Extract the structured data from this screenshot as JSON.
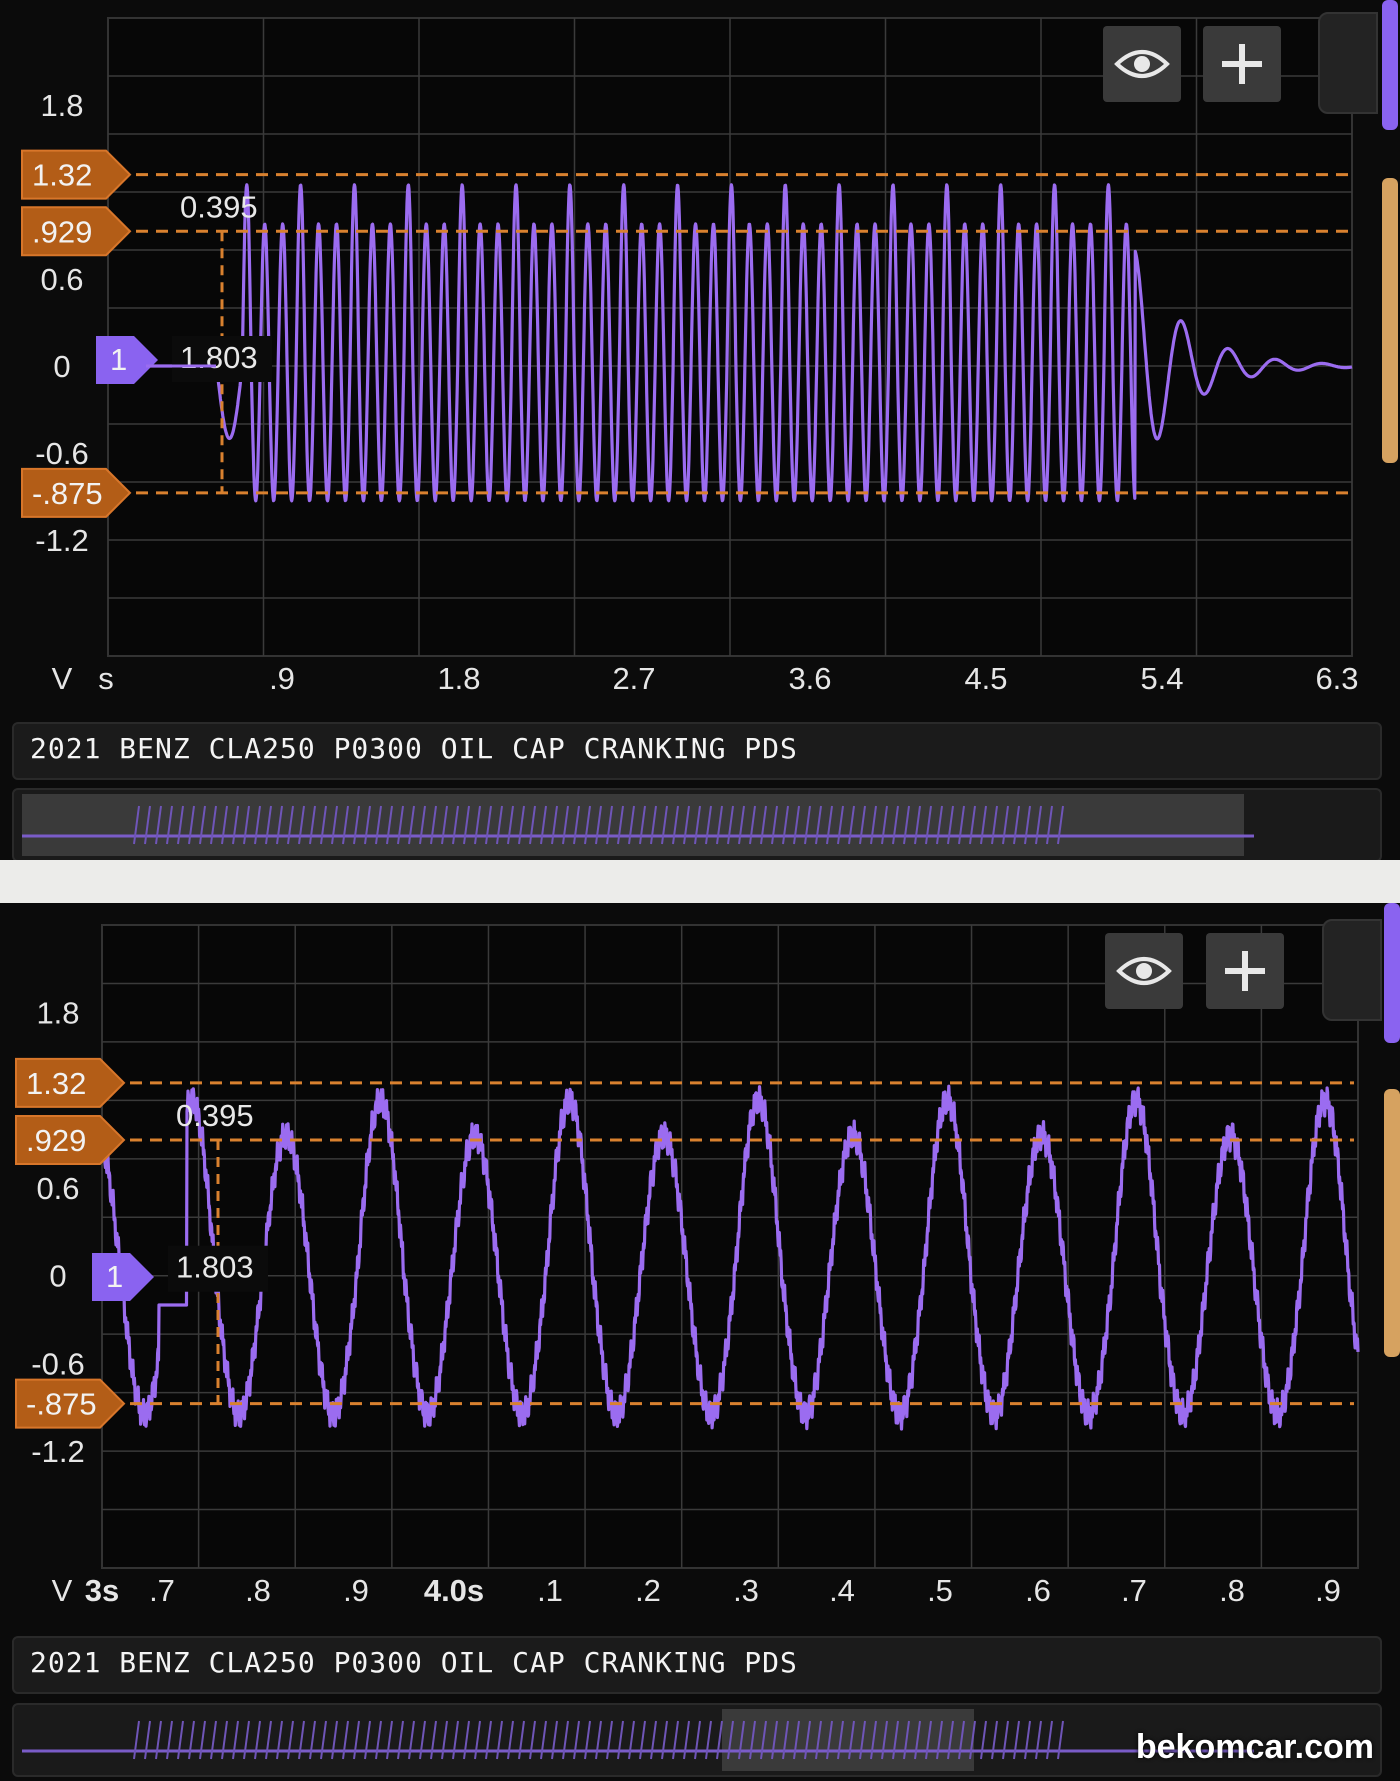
{
  "colors": {
    "trace": "#9b6cf0",
    "cursor": "#d9812f",
    "grid": "#3a3a3a",
    "background": "#0b0b0b",
    "tab_purple": "#8a63f0",
    "tab_orange": "#d6a260"
  },
  "icons": {
    "view": "eye-icon",
    "add": "plus-icon"
  },
  "watermark": "bekomcar.com",
  "panels": [
    {
      "title": "2021 BENZ CLA250 P0300 OIL CAP CRANKING PDS",
      "y_tick_labels": [
        "1.8",
        "0.6",
        "0",
        "-0.6",
        "-1.2"
      ],
      "y_unit": "V",
      "x_unit": "s",
      "x_tick_labels": [
        ".9",
        "1.8",
        "2.7",
        "3.6",
        "4.5",
        "5.4",
        "6.3"
      ],
      "cursor_labels": [
        "1.32",
        ".929",
        "-.875"
      ],
      "delta_top": "0.395",
      "delta_time": "1.803",
      "channel_label": "1"
    },
    {
      "title": "2021 BENZ CLA250 P0300 OIL CAP CRANKING PDS",
      "y_tick_labels": [
        "1.8",
        "0.6",
        "0",
        "-0.6",
        "-1.2"
      ],
      "y_unit": "V",
      "x_tick_labels": [
        "3s",
        ".7",
        ".8",
        ".9",
        "4.0s",
        ".1",
        ".2",
        ".3",
        ".4",
        ".5",
        ".6",
        ".7",
        ".8",
        ".9"
      ],
      "cursor_labels": [
        "1.32",
        ".929",
        "-.875"
      ],
      "delta_top": "0.395",
      "delta_time": "1.803",
      "channel_label": "1"
    }
  ],
  "chart_data": [
    {
      "type": "line",
      "title": "",
      "xlabel": "s",
      "ylabel": "V",
      "xlim": [
        0,
        6.3
      ],
      "ylim": [
        -2.0,
        2.4
      ],
      "horizontal_cursors": [
        1.32,
        0.929,
        -0.875
      ],
      "series": [
        {
          "description_points": [
            [
              0,
              0
            ],
            [
              0.55,
              0
            ],
            [
              0.62,
              -0.5
            ],
            [
              0.68,
              0.929
            ],
            [
              5.15,
              0.9
            ],
            [
              5.2,
              -0.875
            ],
            [
              5.3,
              0.7
            ],
            [
              5.45,
              -0.2
            ],
            [
              5.6,
              0.3
            ],
            [
              5.8,
              -0.05
            ],
            [
              6.3,
              0
            ]
          ],
          "oscillation_frequency_hz": 11,
          "oscillation_start_s": 0.62,
          "oscillation_end_s": 5.25,
          "peak_v": 0.929,
          "trough_v": -0.875
        }
      ]
    },
    {
      "type": "line",
      "title": "",
      "xlabel": "",
      "ylabel": "V",
      "xlim": [
        3.6,
        4.93
      ],
      "ylim": [
        -2.0,
        2.4
      ],
      "horizontal_cursors": [
        1.32,
        0.929,
        -0.875
      ],
      "series": [
        {
          "oscillation_frequency_hz": 10,
          "peak_v": 0.929,
          "trough_v": -0.875,
          "tall_peak_v": 1.32
        }
      ]
    }
  ]
}
